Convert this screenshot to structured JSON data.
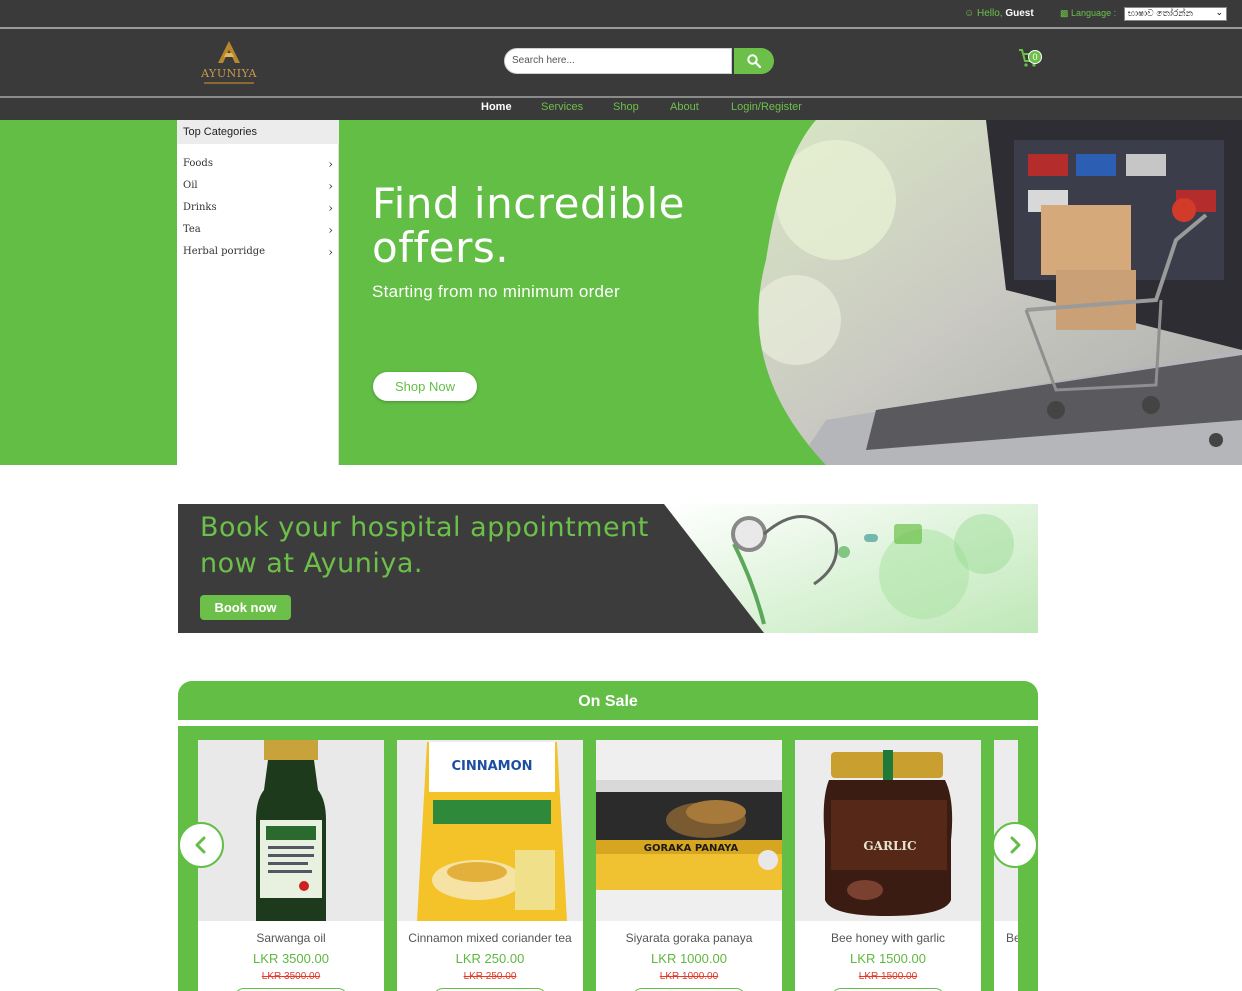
{
  "topbar": {
    "greeting_prefix": "Hello,",
    "greeting_user": "Guest",
    "language_label": "Language :",
    "language_selected": "භාෂාව තෝරන්න"
  },
  "header": {
    "logo_text": "AYUNIYA",
    "search_placeholder": "Search here...",
    "cart_count": "0"
  },
  "nav": {
    "items": [
      {
        "label": "Home",
        "active": true
      },
      {
        "label": "Services",
        "active": false
      },
      {
        "label": "Shop",
        "active": false
      },
      {
        "label": "About",
        "active": false
      },
      {
        "label": "Login/Register",
        "active": false
      }
    ]
  },
  "categories": {
    "title": "Top Categories",
    "items": [
      "Foods",
      "Oil",
      "Drinks",
      "Tea",
      "Herbal porridge"
    ]
  },
  "hero": {
    "title_line1": "Find incredible",
    "title_line2": "offers.",
    "subtitle": "Starting from no minimum order",
    "cta": "Shop Now"
  },
  "appointment": {
    "line1": "Book your hospital appointment",
    "line2": "now at Ayuniya.",
    "cta": "Book now"
  },
  "on_sale": {
    "title": "On Sale",
    "products": [
      {
        "name": "Sarwanga oil",
        "price": "LKR 3500.00",
        "old_price": "LKR 3500.00"
      },
      {
        "name": "Cinnamon mixed coriander tea",
        "price": "LKR 250.00",
        "old_price": "LKR 250.00"
      },
      {
        "name": "Siyarata goraka panaya",
        "price": "LKR 1000.00",
        "old_price": "LKR 1000.00"
      },
      {
        "name": "Bee honey with garlic",
        "price": "LKR 1500.00",
        "old_price": "LKR 1500.00"
      },
      {
        "name": "Be",
        "price": "",
        "old_price": ""
      }
    ],
    "product_labels": {
      "p2_brand": "CINNAMON",
      "p3_label": "GORAKA PANAYA",
      "p4_label": "GARLIC"
    }
  },
  "colors": {
    "brand_green": "#63be45",
    "dark": "#3a3a3a",
    "old_price_red": "#e03a2a"
  }
}
